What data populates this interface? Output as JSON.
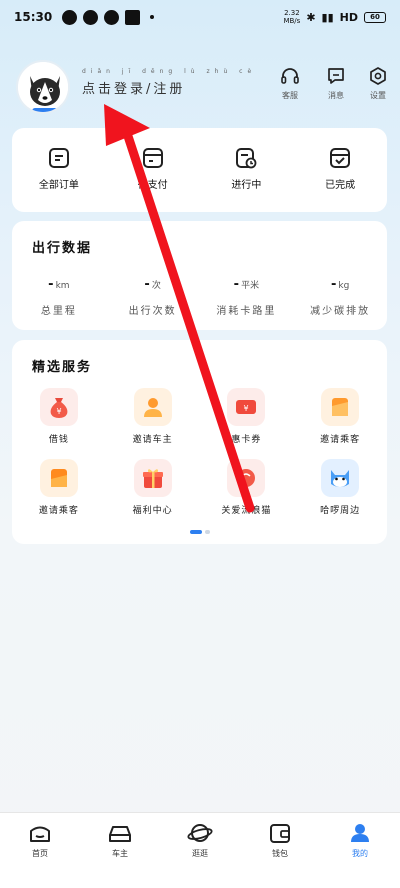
{
  "status_bar": {
    "time": "15:30",
    "speed": "2.32",
    "speed_unit": "MB/s",
    "network": "HD",
    "battery": "60"
  },
  "header": {
    "login_label": "点击登录/注册",
    "login_pinyin": "diǎn jī dēng lù zhù cè",
    "buttons": [
      {
        "label": "客服",
        "icon": "headset-icon"
      },
      {
        "label": "消息",
        "icon": "message-icon"
      },
      {
        "label": "设置",
        "icon": "settings-icon"
      }
    ]
  },
  "orders": [
    {
      "label": "全部订单",
      "icon": "all-orders-icon"
    },
    {
      "label": "待支付",
      "icon": "pending-payment-icon"
    },
    {
      "label": "进行中",
      "icon": "in-progress-icon"
    },
    {
      "label": "已完成",
      "icon": "completed-icon"
    }
  ],
  "stats": {
    "title": "出行数据",
    "items": [
      {
        "value": "-",
        "unit": "km",
        "label": "总里程"
      },
      {
        "value": "-",
        "unit": "次",
        "label": "出行次数"
      },
      {
        "value": "-",
        "unit": "平米",
        "label": "消耗卡路里"
      },
      {
        "value": "-",
        "unit": "kg",
        "label": "减少碳排放"
      }
    ]
  },
  "services": {
    "title": "精选服务",
    "items": [
      {
        "label": "借钱",
        "icon": "money-bag-icon",
        "bg": "#fdecea"
      },
      {
        "label": "邀请车主",
        "icon": "driver-invite-icon",
        "bg": "#fff1e0"
      },
      {
        "label": "惠卡券",
        "icon": "coupon-icon",
        "bg": "#fdecea"
      },
      {
        "label": "邀请乘客",
        "icon": "passenger-invite-icon",
        "bg": "#fff1e0"
      },
      {
        "label": "邀请乘客",
        "icon": "passenger-card-icon",
        "bg": "#fff1e0"
      },
      {
        "label": "福利中心",
        "icon": "gift-icon",
        "bg": "#fdecea"
      },
      {
        "label": "关爱流浪猫",
        "icon": "cat-care-icon",
        "bg": "#fdecea"
      },
      {
        "label": "哈啰周边",
        "icon": "mascot-icon",
        "bg": "#e3f0ff"
      }
    ]
  },
  "tabs": [
    {
      "label": "首页",
      "icon": "home-icon",
      "active": false
    },
    {
      "label": "车主",
      "icon": "car-icon",
      "active": false
    },
    {
      "label": "逛逛",
      "icon": "planet-icon",
      "active": false
    },
    {
      "label": "钱包",
      "icon": "wallet-icon",
      "active": false
    },
    {
      "label": "我的",
      "icon": "profile-icon",
      "active": true
    }
  ],
  "colors": {
    "accent": "#2d7ff0",
    "annotation": "#f0141e"
  }
}
